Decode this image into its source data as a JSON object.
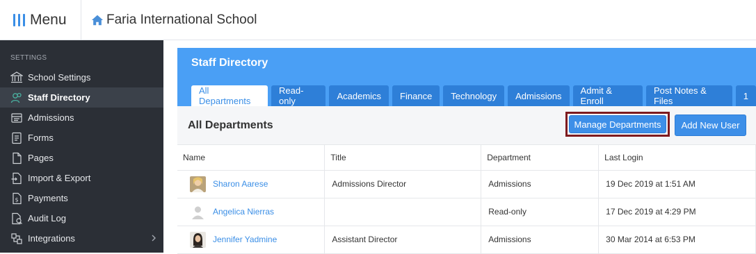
{
  "topbar": {
    "menu_label": "Menu",
    "school_name": "Faria International School"
  },
  "sidebar": {
    "section_label": "SETTINGS",
    "items": [
      {
        "label": "School Settings",
        "icon": "school-icon",
        "active": false
      },
      {
        "label": "Staff Directory",
        "icon": "users-icon",
        "active": true
      },
      {
        "label": "Admissions",
        "icon": "admissions-icon",
        "active": false
      },
      {
        "label": "Forms",
        "icon": "forms-icon",
        "active": false
      },
      {
        "label": "Pages",
        "icon": "pages-icon",
        "active": false
      },
      {
        "label": "Import & Export",
        "icon": "import-export-icon",
        "active": false
      },
      {
        "label": "Payments",
        "icon": "payments-icon",
        "active": false
      },
      {
        "label": "Audit Log",
        "icon": "audit-log-icon",
        "active": false
      },
      {
        "label": "Integrations",
        "icon": "integrations-icon",
        "active": false
      }
    ]
  },
  "main": {
    "title": "Staff Directory",
    "tabs": [
      "All Departments",
      "Read-only",
      "Academics",
      "Finance",
      "Technology",
      "Admissions",
      "Admit & Enroll",
      "Post Notes & Files",
      "1"
    ],
    "active_tab": "All Departments",
    "section_heading": "All Departments",
    "manage_button": "Manage Departments",
    "add_button": "Add New User",
    "table": {
      "columns": [
        "Name",
        "Title",
        "Department",
        "Last Login"
      ],
      "rows": [
        {
          "name": "Sharon Aarese",
          "title": "Admissions Director",
          "department": "Admissions",
          "last_login": "19 Dec 2019 at 1:51 AM"
        },
        {
          "name": "Angelica Nierras",
          "title": "",
          "department": "Read-only",
          "last_login": "17 Dec 2019 at 4:29 PM"
        },
        {
          "name": "Jennifer Yadmine",
          "title": "Assistant Director",
          "department": "Admissions",
          "last_login": "30 Mar 2014 at 6:53 PM"
        }
      ]
    }
  },
  "colors": {
    "accent": "#4a9ff5",
    "tab": "#2e7fd8",
    "sidebar_bg": "#2b2f36",
    "highlight_border": "#7d1a1f"
  }
}
